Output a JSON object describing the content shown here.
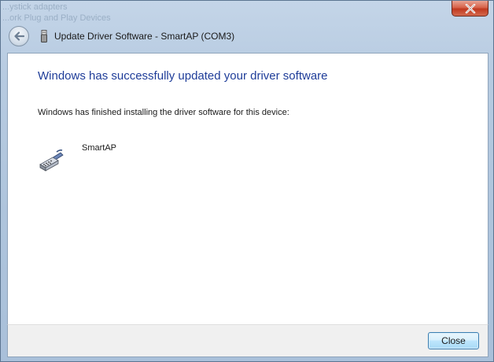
{
  "background_window": {
    "ghost_lines": [
      "...ystick adapters",
      "...ork Plug and Play Devices"
    ]
  },
  "window": {
    "title": "Update Driver Software - SmartAP (COM3)",
    "icons": {
      "back": "back-arrow-icon",
      "title": "usb-device-icon",
      "close": "close-icon",
      "device": "serial-port-icon"
    }
  },
  "content": {
    "heading": "Windows has successfully updated your driver software",
    "subtext": "Windows has finished installing the driver software for this device:",
    "device_name": "SmartAP"
  },
  "footer": {
    "close_label": "Close"
  },
  "colors": {
    "heading": "#1f3d99",
    "close_x": "#c0391f"
  }
}
